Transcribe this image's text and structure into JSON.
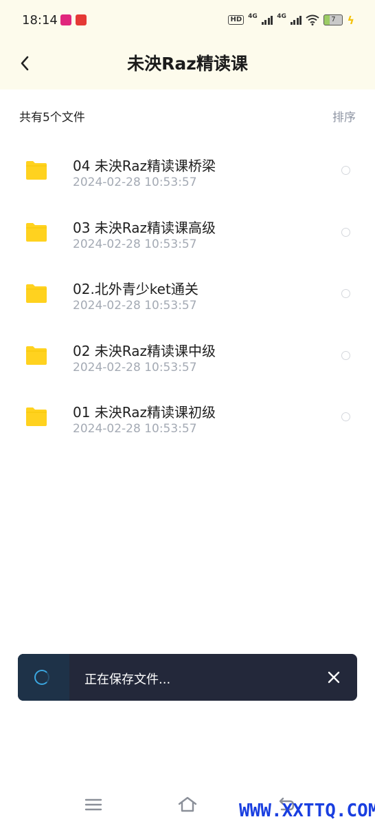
{
  "status_bar": {
    "time": "18:14",
    "network_1": "4G",
    "network_2": "4G",
    "hd_label": "HD",
    "battery_level": "7"
  },
  "header": {
    "back_icon": "chevron-left-icon",
    "title": "未泱Raz精读课"
  },
  "list_header": {
    "count_text": "共有5个文件",
    "sort_label": "排序"
  },
  "files": [
    {
      "name": "04 未泱Raz精读课桥梁",
      "date": "2024-02-28  10:53:57"
    },
    {
      "name": "03 未泱Raz精读课高级",
      "date": "2024-02-28  10:53:57"
    },
    {
      "name": "02.北外青少ket通关",
      "date": "2024-02-28  10:53:57"
    },
    {
      "name": "02 未泱Raz精读课中级",
      "date": "2024-02-28  10:53:57"
    },
    {
      "name": "01 未泱Raz精读课初级",
      "date": "2024-02-28  10:53:57"
    }
  ],
  "toast": {
    "message": "正在保存文件...",
    "close_icon": "close-icon"
  },
  "nav_bar": {
    "menu_icon": "menu-icon",
    "home_icon": "home-icon",
    "back_icon": "back-icon"
  },
  "watermark": "WWW.XXTTQ.COM",
  "colors": {
    "header_bg": "#fdfbec",
    "folder": "#ffd21f",
    "date_text": "#a4aab4",
    "toast_bg": "#23283a",
    "spinner": "#3ba7e0",
    "watermark": "#1a3fe0"
  }
}
